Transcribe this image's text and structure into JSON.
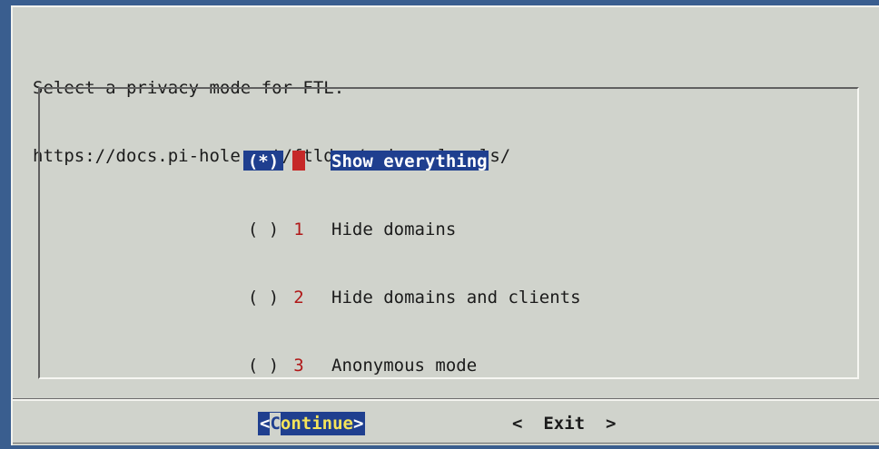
{
  "prompt": {
    "line1": "Select a privacy mode for FTL.",
    "line2": "https://docs.pi-hole.net/ftldns/privacylevels/"
  },
  "options": [
    {
      "radio": "(*)",
      "number": "0",
      "label": "Show everything",
      "selected": true
    },
    {
      "radio": "( )",
      "number": "1",
      "label": "Hide domains",
      "selected": false
    },
    {
      "radio": "( )",
      "number": "2",
      "label": "Hide domains and clients",
      "selected": false
    },
    {
      "radio": "( )",
      "number": "3",
      "label": "Anonymous mode",
      "selected": false
    }
  ],
  "buttons": {
    "continue_open": "<",
    "continue_hot": "C",
    "continue_rest": "ontinue",
    "continue_close": ">",
    "exit": "<  Exit  >"
  },
  "colors": {
    "background": "#3a5e8f",
    "dialog": "#d0d3cc",
    "highlight": "#1f3f8f",
    "number": "#b01818",
    "hotkey": "#f5e45a"
  }
}
